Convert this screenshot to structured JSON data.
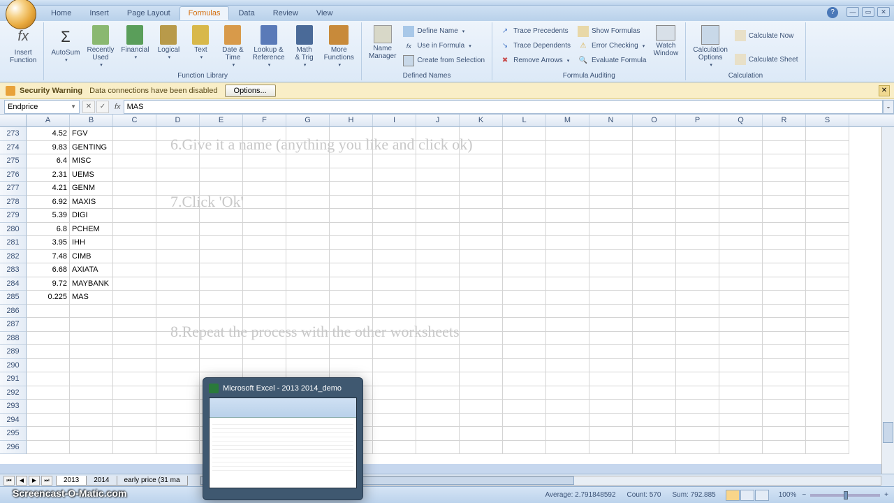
{
  "tabs": [
    "Home",
    "Insert",
    "Page Layout",
    "Formulas",
    "Data",
    "Review",
    "View"
  ],
  "active_tab": "Formulas",
  "ribbon": {
    "insert_fn": "Insert\nFunction",
    "library": {
      "autosum": "AutoSum",
      "recently": "Recently\nUsed",
      "financial": "Financial",
      "logical": "Logical",
      "text": "Text",
      "datetime": "Date &\nTime",
      "lookup": "Lookup &\nReference",
      "math": "Math\n& Trig",
      "more": "More\nFunctions",
      "label": "Function Library"
    },
    "names": {
      "manager": "Name\nManager",
      "define": "Define Name",
      "use": "Use in Formula",
      "create": "Create from Selection",
      "label": "Defined Names"
    },
    "audit": {
      "precedents": "Trace Precedents",
      "dependents": "Trace Dependents",
      "remove": "Remove Arrows",
      "show": "Show Formulas",
      "error": "Error Checking",
      "eval": "Evaluate Formula",
      "watch": "Watch\nWindow",
      "label": "Formula Auditing"
    },
    "calc": {
      "options": "Calculation\nOptions",
      "now": "Calculate Now",
      "sheet": "Calculate Sheet",
      "label": "Calculation"
    }
  },
  "security": {
    "title": "Security Warning",
    "msg": "Data connections have been disabled",
    "btn": "Options..."
  },
  "namebox": "Endprice",
  "formula": "MAS",
  "columns": [
    "A",
    "B",
    "C",
    "D",
    "E",
    "F",
    "G",
    "H",
    "I",
    "J",
    "K",
    "L",
    "M",
    "N",
    "O",
    "P",
    "Q",
    "R",
    "S"
  ],
  "row_start": 273,
  "rows": [
    {
      "a": "4.52",
      "b": "FGV"
    },
    {
      "a": "9.83",
      "b": "GENTING"
    },
    {
      "a": "6.4",
      "b": "MISC"
    },
    {
      "a": "2.31",
      "b": "UEMS"
    },
    {
      "a": "4.21",
      "b": "GENM"
    },
    {
      "a": "6.92",
      "b": "MAXIS"
    },
    {
      "a": "5.39",
      "b": "DIGI"
    },
    {
      "a": "6.8",
      "b": "PCHEM"
    },
    {
      "a": "3.95",
      "b": "IHH"
    },
    {
      "a": "7.48",
      "b": "CIMB"
    },
    {
      "a": "6.68",
      "b": "AXIATA"
    },
    {
      "a": "9.72",
      "b": "MAYBANK"
    },
    {
      "a": "0.225",
      "b": "MAS"
    },
    {
      "a": "",
      "b": ""
    },
    {
      "a": "",
      "b": ""
    },
    {
      "a": "",
      "b": ""
    },
    {
      "a": "",
      "b": ""
    },
    {
      "a": "",
      "b": ""
    },
    {
      "a": "",
      "b": ""
    },
    {
      "a": "",
      "b": ""
    },
    {
      "a": "",
      "b": ""
    },
    {
      "a": "",
      "b": ""
    },
    {
      "a": "",
      "b": ""
    },
    {
      "a": "",
      "b": ""
    }
  ],
  "overlay": {
    "l1": "6.Give it a name (anything you like and click ok)",
    "l2": "7.Click 'Ok'",
    "l3": "8.Repeat the process with the other worksheets"
  },
  "preview": "Microsoft Excel - 2013 2014_demo",
  "sheets": [
    "2013",
    "2014",
    "early price (31 ma"
  ],
  "status": {
    "avg": "Average: 2.791848592",
    "count": "Count: 570",
    "sum": "Sum: 792.885",
    "zoom": "100%"
  },
  "watermark": "Screencast-O-Matic.com"
}
